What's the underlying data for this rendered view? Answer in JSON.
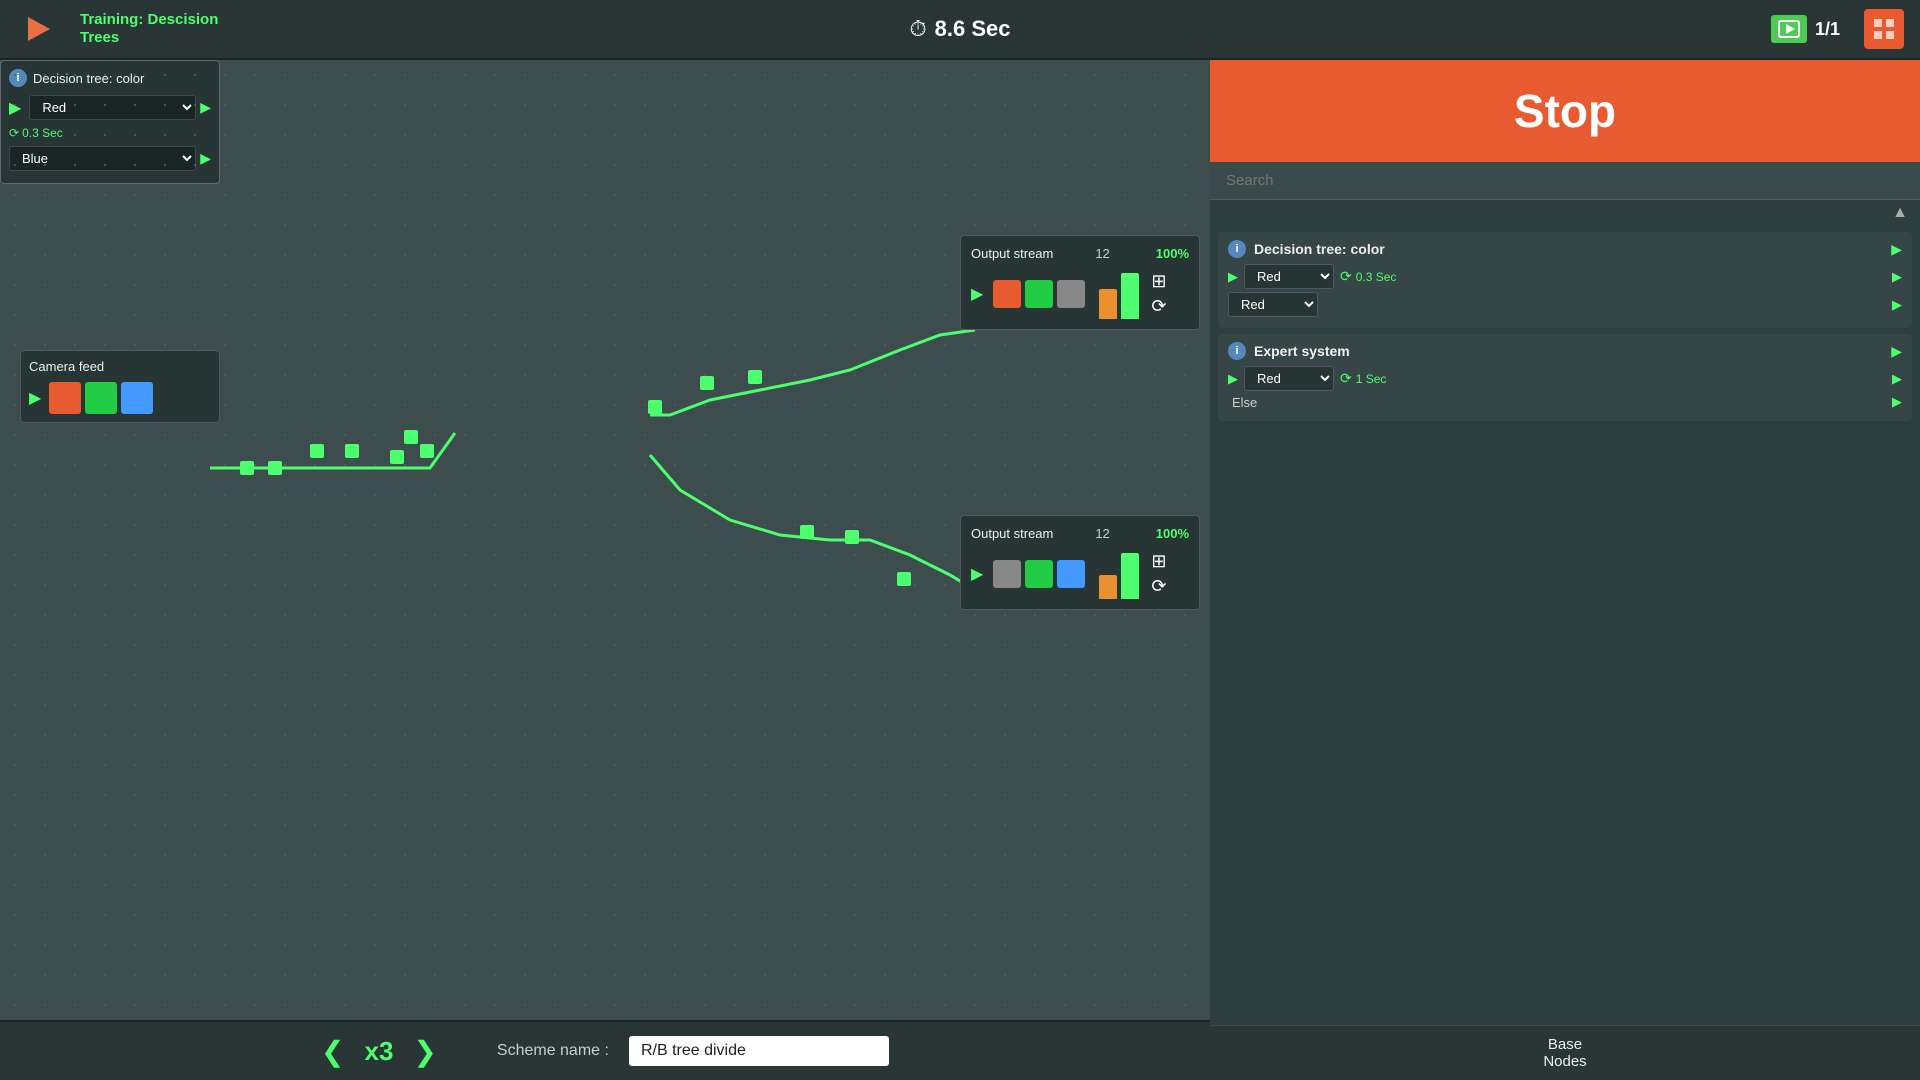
{
  "header": {
    "back_label": "←",
    "title_line1": "Training: Descision",
    "title_line2": "Trees",
    "progress_icon": "▶",
    "progress": "1/1",
    "timer_icon": "⏱",
    "timer": "8.6 Sec",
    "toolbar_icon": "🏠"
  },
  "bottom_bar": {
    "chevron_left": "❮",
    "multiplier": "x3",
    "chevron_right": "❯",
    "scheme_label": "Scheme name :",
    "scheme_name": "R/B tree divide"
  },
  "right_panel": {
    "stop_label": "Stop",
    "search_placeholder": "Search",
    "items": [
      {
        "id": "decision-tree-color",
        "title": "Decision tree: color",
        "dropdown1": "Red",
        "timer": "0.3 Sec",
        "dropdown2": "Red"
      },
      {
        "id": "expert-system",
        "title": "Expert system",
        "dropdown1": "Red",
        "timer": "1 Sec",
        "dropdown2": "Else"
      }
    ],
    "base_nodes_label": "Base\nNodes"
  },
  "canvas": {
    "camera_feed": {
      "title": "Camera feed",
      "squares": [
        "red",
        "green2",
        "blue"
      ]
    },
    "decision_tree": {
      "title": "Decision tree: color",
      "dropdown1": "Red",
      "timer": "0.3 Sec",
      "dropdown2": "Blue"
    },
    "output_top": {
      "title": "Output stream",
      "count": "12",
      "percent": "100%",
      "squares": [
        "red",
        "green",
        "gray"
      ]
    },
    "output_bottom": {
      "title": "Output stream",
      "count": "12",
      "percent": "100%",
      "squares": [
        "gray",
        "green",
        "blue"
      ]
    }
  }
}
